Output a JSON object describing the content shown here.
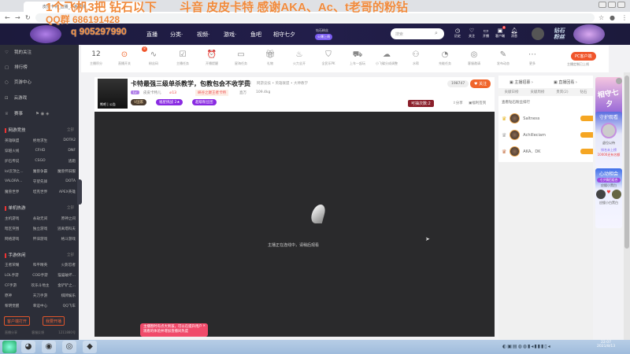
{
  "browser": {
    "tab_title": "皮皮卡特_直播_斗鱼直播",
    "url": ""
  },
  "overlay": {
    "line1": "1个飞机3把 钻石以下",
    "line2": "斗音 皮皮卡特 感谢AKA、Ac、t老哥的粉钻",
    "line3": "QQ群 686191428",
    "line4": "q 905297990"
  },
  "header": {
    "nav": [
      "直播",
      "分类·",
      "视频·",
      "游戏·",
      "鱼吧",
      "相守七夕"
    ],
    "promo_small": "钻石粉丝",
    "promo_btn": "火爆上线",
    "search_placeholder": "搜索",
    "icons": [
      "历史",
      "关注",
      "开播",
      "客户端",
      "消息"
    ],
    "brand_badge": "钻石粉丝",
    "notif_count": "8"
  },
  "sidebar": {
    "items": [
      "我的关注",
      "排行榜",
      "页游中心",
      "云游戏",
      "赛事"
    ],
    "sections": [
      {
        "title": "网游竞技",
        "more": "全部",
        "games": [
          "英雄联盟",
          "绝地求生",
          "DOTA2",
          "穿越火线",
          "CFHD",
          "DNF",
          "炉石传说",
          "CSGO",
          "逃跑",
          "lol云顶之...",
          "魔兽争霸",
          "魔兽怀旧服",
          "VALORA...",
          "守望先锋",
          "DOTA",
          "魔兽世界",
          "坦克世界",
          "APEX英雄"
        ]
      },
      {
        "title": "单机热游",
        "more": "全部",
        "games": [
          "主机游戏",
          "永劫无间",
          "原神之间",
          "暗区突围",
          "独立游戏",
          "逃离塔科夫",
          "网络游戏",
          "怀旧游戏",
          "格斗游戏"
        ]
      },
      {
        "title": "手游休闲",
        "more": "全部",
        "games": [
          "王者荣耀",
          "和平精英",
          "火影忍者",
          "LOL手游",
          "COD手游",
          "猫猫破坏...",
          "CF手游",
          "欢乐斗地主",
          "金铲铲之...",
          "原神",
          "天刀手游",
          "棋牌娱乐",
          "黎明觉醒",
          "幸运中心",
          "QQ飞车"
        ]
      }
    ],
    "btn_client": "客户端打开",
    "btn_live": "我要开播",
    "footer": [
      "直播分享",
      "客服反馈",
      "1211880号"
    ]
  },
  "toolbar": {
    "score": "12",
    "score_label": "主播积分",
    "toggle_badge": "8",
    "tools": [
      "直播开关",
      "粉丝码",
      "主播任务",
      "开播提醒",
      "星海任务",
      "礼物",
      "火力全开",
      "全民乐PK",
      "上车一起玩",
      "小飞碟分成调整",
      "水帮",
      "充能任务",
      "客服邀请",
      "发布动态",
      "更多"
    ],
    "pc_client": "PC客户端",
    "pc_sub": "主播定制已上线"
  },
  "stream": {
    "title": "卡特最强三级单杀教学，包教包会不收学费",
    "report": "举报",
    "category": "网游竞技 • 英雄联盟 • 大神教学",
    "level_badge": "Lv",
    "streamer": "皮皮卡特儿",
    "hot": "13",
    "room_tag": "峡谷之巅王者卡特",
    "viewers": "直万",
    "weight": "109.4kg",
    "vip": "V国家",
    "star_badge": "福星挑战",
    "star_count": "2",
    "super_badge": "超级粉丝团",
    "follower_count": "198747",
    "follow_btn": "关注",
    "lottery": "可抽次数:2",
    "share": "分享",
    "client_watch": "福利签到",
    "avatar_caption": "熊吧 | 公告"
  },
  "video": {
    "status": "主播正在连线中，请稍后观看",
    "toast": "主播暂时有点大男孩，可以在提升用户观看的体验并增加直播间热度",
    "toast_close": "×"
  },
  "rank": {
    "tab_anchor": "主播招募",
    "tab_replay": "直播回看",
    "tabs": [
      "贡献日榜",
      "贡献周榜",
      "贵宾(2)",
      "钻石"
    ],
    "subtitle": "查看钻石粉丝排行",
    "users": [
      {
        "name": "Saltness",
        "crown": "#e6b422"
      },
      {
        "name": "Achilleciam",
        "crown": "#aaaaaa"
      },
      {
        "name": "AKA、DK",
        "crown": "#c8764a"
      }
    ]
  },
  "banners": {
    "b1_title": "相守七夕",
    "b2_title": "守护观看",
    "b2_sub": "虚位以待",
    "b2_foot": "排名未上榜",
    "b2_foot2": "10000还有名额",
    "b3_title": "心动相会",
    "b3_sub": "七夕情侣组合",
    "b3_a": "应援小黑白",
    "b3_b": "应援小白黑白"
  },
  "taskbar": {
    "time": "22:07",
    "date": "2021/8/13"
  }
}
